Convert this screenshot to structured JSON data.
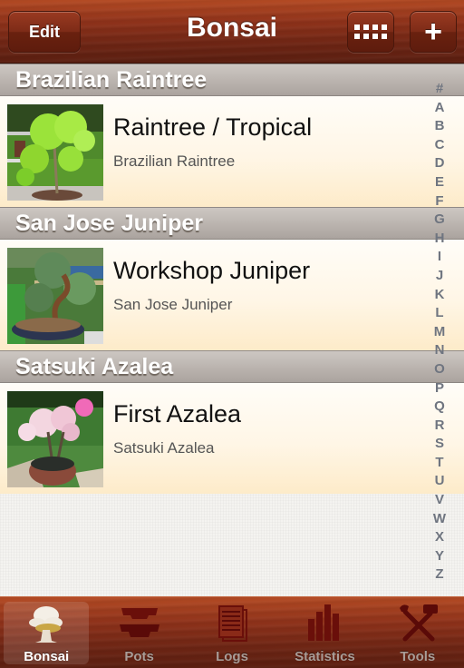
{
  "navbar": {
    "title": "Bonsai",
    "edit_label": "Edit",
    "grid_icon": "grid-view-icon",
    "add_icon": "plus-icon",
    "add_label": "+"
  },
  "sections": [
    {
      "header": "Brazilian Raintree",
      "items": [
        {
          "title": "Raintree / Tropical",
          "subtitle": "Brazilian Raintree",
          "thumbnail": "raintree-bonsai-photo"
        }
      ]
    },
    {
      "header": "San Jose Juniper",
      "items": [
        {
          "title": "Workshop Juniper",
          "subtitle": "San Jose Juniper",
          "thumbnail": "juniper-bonsai-photo"
        }
      ]
    },
    {
      "header": "Satsuki Azalea",
      "items": [
        {
          "title": "First Azalea",
          "subtitle": "Satsuki Azalea",
          "thumbnail": "azalea-bonsai-photo"
        }
      ]
    }
  ],
  "index": [
    "#",
    "A",
    "B",
    "C",
    "D",
    "E",
    "F",
    "G",
    "H",
    "I",
    "J",
    "K",
    "L",
    "M",
    "N",
    "O",
    "P",
    "Q",
    "R",
    "S",
    "T",
    "U",
    "V",
    "W",
    "X",
    "Y",
    "Z"
  ],
  "tabbar": {
    "active": "Bonsai",
    "tabs": [
      {
        "label": "Bonsai",
        "icon": "bonsai-tree-icon"
      },
      {
        "label": "Pots",
        "icon": "pots-icon"
      },
      {
        "label": "Logs",
        "icon": "logs-icon"
      },
      {
        "label": "Statistics",
        "icon": "statistics-icon"
      },
      {
        "label": "Tools",
        "icon": "tools-icon"
      }
    ]
  },
  "colors": {
    "wood_dark": "#6e2514",
    "wood_light": "#b34a23",
    "header_gray": "#bcb5b0",
    "row_cream": "#fff6e6",
    "index_text": "#6f7580",
    "tab_inactive_text": "#a99c97",
    "tab_icon_inactive": "#6a0f0a"
  }
}
